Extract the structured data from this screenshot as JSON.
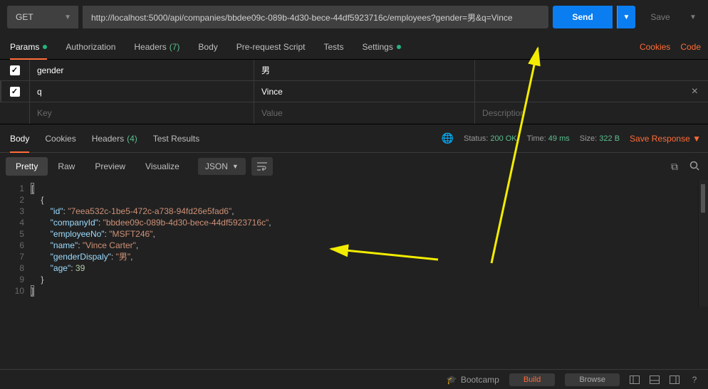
{
  "request": {
    "method": "GET",
    "url": "http://localhost:5000/api/companies/bbdee09c-089b-4d30-bece-44df5923716c/employees?gender=男&q=Vince",
    "send_label": "Send",
    "save_label": "Save"
  },
  "request_tabs": {
    "params": "Params",
    "auth": "Authorization",
    "headers": "Headers",
    "headers_count": "(7)",
    "body": "Body",
    "prereq": "Pre-request Script",
    "tests": "Tests",
    "settings": "Settings",
    "cookies_link": "Cookies",
    "code_link": "Code"
  },
  "params": {
    "rows": [
      {
        "key": "gender",
        "value": "男"
      },
      {
        "key": "q",
        "value": "Vince"
      }
    ],
    "ph_key": "Key",
    "ph_value": "Value",
    "ph_desc": "Description"
  },
  "response_tabs": {
    "body": "Body",
    "cookies": "Cookies",
    "headers": "Headers",
    "headers_count": "(4)",
    "test_results": "Test Results"
  },
  "status": {
    "label": "Status:",
    "value": "200 OK",
    "time_label": "Time:",
    "time_value": "49 ms",
    "size_label": "Size:",
    "size_value": "322 B",
    "save_response": "Save Response"
  },
  "view": {
    "pretty": "Pretty",
    "raw": "Raw",
    "preview": "Preview",
    "visualize": "Visualize",
    "format": "JSON"
  },
  "json_body": {
    "id": "7eea532c-1be5-472c-a738-94fd26e5fad6",
    "companyId": "bbdee09c-089b-4d30-bece-44df5923716c",
    "employeeNo": "MSFT246",
    "name": "Vince Carter",
    "genderDispaly": "男",
    "age": 39
  },
  "footer": {
    "bootcamp": "Bootcamp",
    "build": "Build",
    "browse": "Browse"
  }
}
